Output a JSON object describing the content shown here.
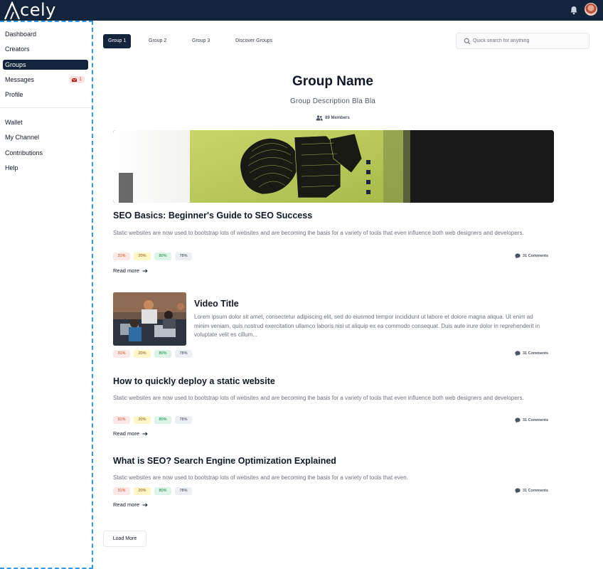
{
  "app": {
    "logo_text": "cely"
  },
  "sidebar": {
    "items": [
      {
        "label": "Dashboard"
      },
      {
        "label": "Creators"
      },
      {
        "label": "Groups"
      },
      {
        "label": "Messages",
        "badge": "1"
      },
      {
        "label": "Profile"
      },
      {
        "label": "Wallet"
      },
      {
        "label": "My Channel"
      },
      {
        "label": "Contributions"
      },
      {
        "label": "Help"
      }
    ]
  },
  "tabs": [
    {
      "label": "Group 1"
    },
    {
      "label": "Group 2"
    },
    {
      "label": "Group 3"
    },
    {
      "label": "Discover Groups"
    }
  ],
  "search": {
    "placeholder": "Quick search for anything"
  },
  "group": {
    "name": "Group Name",
    "description": "Group Description Bla Bla",
    "members": "89 Members"
  },
  "posts": [
    {
      "title": "SEO Basics: Beginner's Guide to SEO Success",
      "body": "Static websites are now used to bootstrap lots of websites and are becoming the basis for a variety of tools that even influence both web designers and developers.",
      "tags": [
        "31%",
        "20%",
        "80%",
        "78%"
      ],
      "comments": "31 Comments",
      "read_more": "Read more"
    },
    {
      "title": "Video Title",
      "body": "Lorem ipsum dolor sit amet, consectetur adipiscing elit, sed do eiusmod tempor incididunt ut labore et dolore magna aliqua. Ut enim ad minim veniam, quis nostrud exercitation ullamco laboris nisi ut aliquip ex ea commodo consequat. Duis aute irure dolor in reprehenderit in voluptate velit es cillum...",
      "tags": [
        "31%",
        "20%",
        "80%",
        "78%"
      ],
      "comments": "31 Comments"
    },
    {
      "title": "How to quickly deploy a static website",
      "body": "Static websites are now used to bootstrap lots of websites and are becoming the basis for a variety of tools that even influence both web designers and developers.",
      "tags": [
        "31%",
        "20%",
        "80%",
        "78%"
      ],
      "comments": "31 Comments",
      "read_more": "Read more"
    },
    {
      "title": "What is SEO? Search Engine Optimization Explained",
      "body": "Static websites are now used to bootstrap lots of websites and are becoming the basis for a variety of tools that even.",
      "tags": [
        "31%",
        "20%",
        "80%",
        "78%"
      ],
      "comments": "31 Comments",
      "read_more": "Read more"
    }
  ],
  "load_more": "Load More",
  "colors": {
    "navy": "#13253d",
    "sidebar_border": "#2f9bf0",
    "tag_red": "#fde8e8",
    "tag_yellow": "#fef6c7",
    "tag_green": "#dcf5e8",
    "tag_gray": "#eceff3"
  },
  "icons": [
    "logo-a-icon",
    "bell-icon",
    "mail-icon",
    "search-icon",
    "people-icon",
    "comment-icon",
    "arrow-right-icon"
  ]
}
